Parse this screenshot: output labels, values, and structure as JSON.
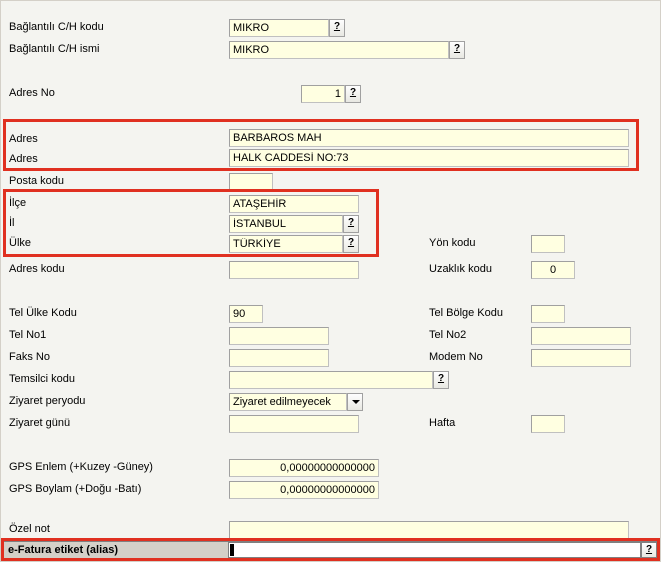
{
  "labels": {
    "baglantili_ch_kodu": "Bağlantılı C/H kodu",
    "baglantili_ch_ismi": "Bağlantılı C/H ismi",
    "adres_no": "Adres No",
    "adres": "Adres",
    "adres2": "Adres",
    "posta_kodu": "Posta kodu",
    "ilce": "İlçe",
    "il": "İl",
    "ulke": "Ülke",
    "adres_kodu": "Adres kodu",
    "yon_kodu": "Yön kodu",
    "uzaklik_kodu": "Uzaklık kodu",
    "tel_ulke_kodu": "Tel Ülke Kodu",
    "tel_bolge_kodu": "Tel Bölge Kodu",
    "tel_no1": "Tel No1",
    "tel_no2": "Tel No2",
    "faks_no": "Faks No",
    "modem_no": "Modem No",
    "temsilci_kodu": "Temsilci kodu",
    "ziyaret_peryodu": "Ziyaret peryodu",
    "ziyaret_gunu": "Ziyaret günü",
    "hafta": "Hafta",
    "gps_enlem": "GPS Enlem (+Kuzey -Güney)",
    "gps_boylam": "GPS Boylam (+Doğu -Batı)",
    "ozel_not": "Özel not",
    "efatura_etiket": "e-Fatura etiket (alias)"
  },
  "values": {
    "baglantili_ch_kodu": "MIKRO",
    "baglantili_ch_ismi": "MIKRO",
    "adres_no": "1",
    "adres": "BARBAROS MAH",
    "adres2": "HALK CADDESİ NO:73",
    "posta_kodu": "",
    "ilce": "ATAŞEHİR",
    "il": "İSTANBUL",
    "ulke": "TÜRKİYE",
    "adres_kodu": "",
    "yon_kodu": "",
    "uzaklik_kodu": "0",
    "tel_ulke_kodu": "90",
    "tel_bolge_kodu": "",
    "tel_no1": "",
    "tel_no2": "",
    "faks_no": "",
    "modem_no": "",
    "temsilci_kodu": "",
    "ziyaret_peryodu": "Ziyaret edilmeyecek",
    "ziyaret_gunu": "",
    "hafta": "",
    "gps_enlem": "0,00000000000000",
    "gps_boylam": "0,00000000000000",
    "ozel_not": "",
    "efatura_etiket": ""
  },
  "help": "?"
}
